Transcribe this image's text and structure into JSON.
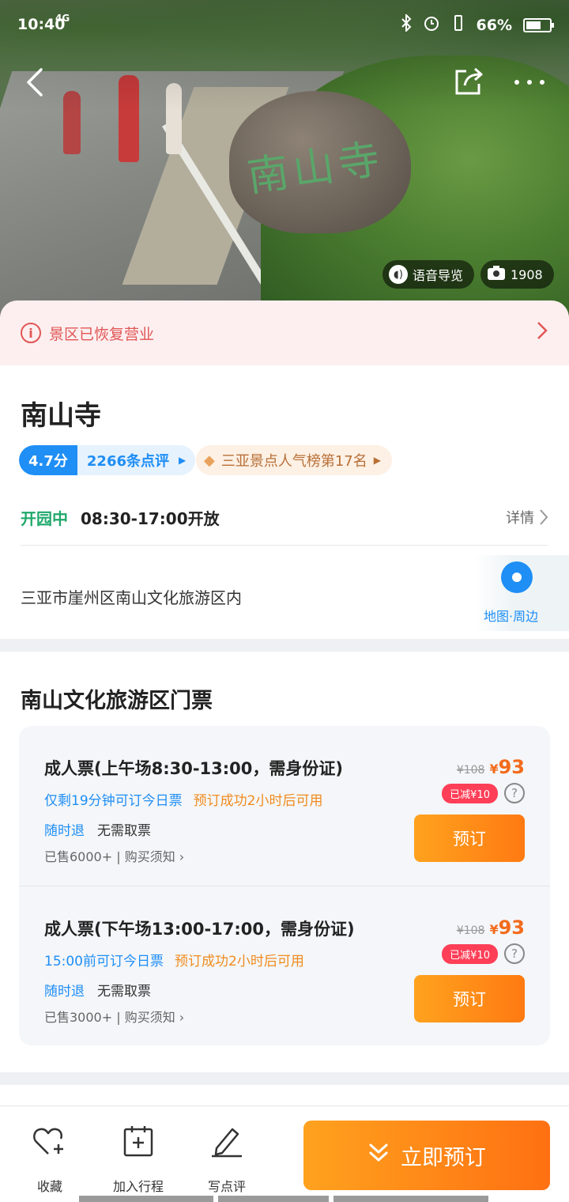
{
  "status_bar": {
    "time": "10:40",
    "network": "4G",
    "battery": "66%",
    "battery_level": 0.66
  },
  "hero": {
    "rock_inscription": "南山寺",
    "audio_guide_label": "语音导览",
    "photo_count": "1908"
  },
  "notice": {
    "text": "景区已恢复营业"
  },
  "info": {
    "title": "南山寺",
    "rating_score": "4.7分",
    "review_count": "2266条点评",
    "rank_text": "三亚景点人气榜第17名",
    "open_status": "开园中",
    "open_hours": "08:30-17:00开放",
    "detail_label": "详情",
    "address": "三亚市崖州区南山文化旅游区内",
    "map_label": "地图·周边"
  },
  "tickets": {
    "section_title": "南山文化旅游区门票",
    "items": [
      {
        "name": "成人票(上午场8:30-13:00，需身份证)",
        "tag_time": "仅剩19分钟可订今日票",
        "tag_use": "预订成功2小时后可用",
        "policy_refund": "随时退",
        "policy_pickup": "无需取票",
        "sold": "已售6000+ | 购买须知",
        "old_price": "¥108",
        "price_symbol": "¥",
        "price": "93",
        "discount": "已减¥10",
        "book_label": "预订"
      },
      {
        "name": "成人票(下午场13:00-17:00，需身份证)",
        "tag_time": "15:00前可订今日票",
        "tag_use": "预订成功2小时后可用",
        "policy_refund": "随时退",
        "policy_pickup": "无需取票",
        "sold": "已售3000+ | 购买须知",
        "old_price": "¥108",
        "price_symbol": "¥",
        "price": "93",
        "discount": "已减¥10",
        "book_label": "预订"
      }
    ]
  },
  "bottom_bar": {
    "favorite_label": "收藏",
    "add_trip_label": "加入行程",
    "review_label": "写点评",
    "book_now_label": "立即预订"
  },
  "colors": {
    "brand_blue": "#1f8ef5",
    "accent_orange": "#ff7a12",
    "notice_red": "#e05655",
    "open_green": "#20a86b"
  }
}
